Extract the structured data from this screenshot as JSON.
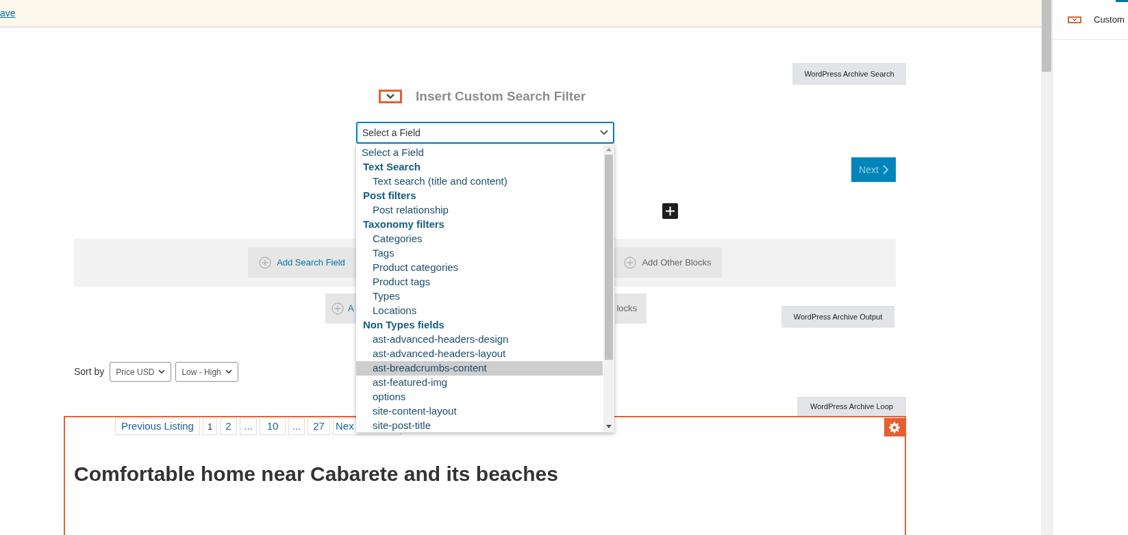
{
  "notice": {
    "link": "ave"
  },
  "side_panel": {
    "item": "Custom"
  },
  "search_block": {
    "label": "WordPress Archive Search",
    "title": "Insert Custom Search Filter",
    "field": {
      "value": "Select a Field",
      "expanded": true
    },
    "next_button": {
      "text": "Next",
      "disabled": true
    },
    "add_buttons": [
      {
        "text": "Add Search Field"
      },
      {
        "text": "Add Other Blocks"
      }
    ]
  },
  "dropdown": {
    "options": [
      {
        "text": "Select a Field",
        "selected": false
      }
    ],
    "groups": [
      {
        "label": "Text Search",
        "options": [
          {
            "text": "Text search (title and content)",
            "selected": false
          }
        ]
      },
      {
        "label": "Post filters",
        "options": [
          {
            "text": "Post relationship",
            "selected": false
          }
        ]
      },
      {
        "label": "Taxonomy filters",
        "options": [
          {
            "text": "Categories",
            "selected": false
          },
          {
            "text": "Tags",
            "selected": false
          },
          {
            "text": "Product categories",
            "selected": false
          },
          {
            "text": "Product tags",
            "selected": false
          },
          {
            "text": "Types",
            "selected": false
          },
          {
            "text": "Locations",
            "selected": false
          }
        ]
      },
      {
        "label": "Non Types fields",
        "options": [
          {
            "text": "ast-advanced-headers-design",
            "selected": false
          },
          {
            "text": "ast-advanced-headers-layout",
            "selected": false
          },
          {
            "text": "ast-breadcrumbs-content",
            "selected": true
          },
          {
            "text": "ast-featured-img",
            "selected": false
          },
          {
            "text": "options",
            "selected": false
          },
          {
            "text": "site-content-layout",
            "selected": false
          },
          {
            "text": "site-post-title",
            "selected": false
          }
        ]
      }
    ]
  },
  "output_block": {
    "label": "WordPress Archive Output",
    "buttons": [
      {
        "text": "A"
      },
      {
        "text": "locks"
      }
    ],
    "sort_label": "Sort by",
    "sort_selects": [
      "Price USD",
      "Low - High"
    ]
  },
  "loop_block": {
    "label": "WordPress Archive Loop",
    "pagination": [
      {
        "text": "Previous Listing",
        "selected": false
      },
      {
        "text": "1",
        "selected": true
      },
      {
        "text": "2",
        "selected": false
      },
      {
        "text": "...",
        "selected": false
      },
      {
        "text": "10",
        "selected": false
      },
      {
        "text": "...",
        "selected": false
      },
      {
        "text": "27",
        "selected": false
      },
      {
        "text": "Nex",
        "selected": false
      }
    ],
    "heading": "Comfortable home near Cabarete and its beaches"
  }
}
